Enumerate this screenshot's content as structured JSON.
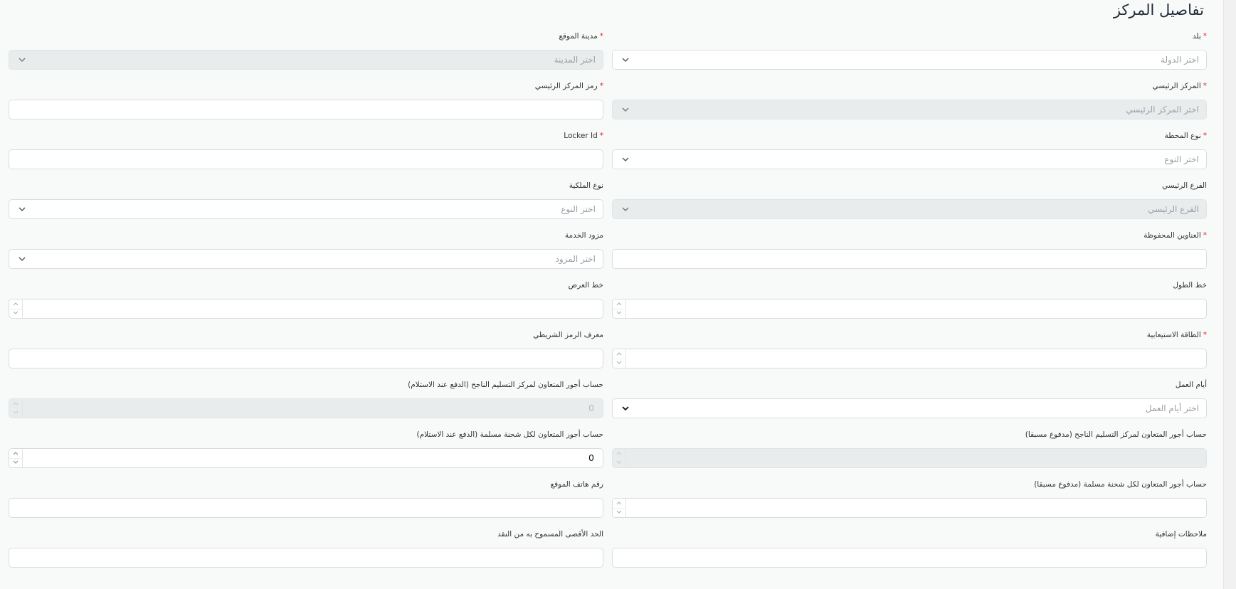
{
  "page_title": "تفاصيل المركز",
  "colors": {
    "required": "#e02424",
    "disabled_bg": "#e9ecec",
    "page_bg": "#f8f9f9"
  },
  "fields": {
    "country": {
      "label": "بلد",
      "required": true,
      "placeholder": "اختر الدولة",
      "type": "select",
      "icon": "chevron-down-icon"
    },
    "city": {
      "label": "مدينة الموقع",
      "required": true,
      "placeholder": "اختر المدينة",
      "type": "select",
      "disabled": true,
      "icon": "chevron-down-icon"
    },
    "main_center": {
      "label": "المركز الرئيسي",
      "required": true,
      "placeholder": "اختر المركز الرئيسي",
      "type": "select",
      "disabled": true,
      "icon": "chevron-down-icon"
    },
    "main_center_code": {
      "label": "رمز المركز الرئيسي",
      "required": true,
      "value": ""
    },
    "station_type": {
      "label": "نوع المحطة",
      "required": true,
      "placeholder": "اختر النوع",
      "type": "select",
      "icon": "chevron-down-icon"
    },
    "locker_id": {
      "label": "Locker Id",
      "required": true,
      "value": ""
    },
    "main_branch": {
      "label": "الفرع الرئيسي",
      "required": false,
      "placeholder": "الفرع الرئيسي",
      "type": "select",
      "disabled": true,
      "icon": "chevron-down-icon"
    },
    "ownership_type": {
      "label": "نوع الملكية",
      "required": false,
      "placeholder": "اختر النوع",
      "type": "select",
      "icon": "chevron-down-icon"
    },
    "saved_addresses": {
      "label": "العناوين المحفوظة",
      "required": true,
      "value": ""
    },
    "service_provider": {
      "label": "مزود الخدمة",
      "required": false,
      "placeholder": "اختر المزود",
      "type": "select",
      "icon": "chevron-down-icon"
    },
    "longitude": {
      "label": "خط الطول",
      "required": false,
      "value": "",
      "type": "number"
    },
    "latitude": {
      "label": "خط العرض",
      "required": false,
      "value": "",
      "type": "number"
    },
    "capacity": {
      "label": "الطاقة الاستيعابية",
      "required": true,
      "value": "",
      "type": "number"
    },
    "barcode_id": {
      "label": "معرف الرمز الشريطي",
      "required": false,
      "value": ""
    },
    "working_days": {
      "label": "أيام العمل",
      "required": false,
      "placeholder": "اختر أيام العمل",
      "type": "select",
      "icon": "chevron-down-icon"
    },
    "fee_cod_center": {
      "label": "حساب أجور المتعاون لمركز التسليم الناجح (الدفع عند الاستلام)",
      "required": false,
      "value": "0",
      "type": "number",
      "disabled": true
    },
    "fee_prepaid_center": {
      "label": "حساب أجور المتعاون لمركز التسليم الناجح (مدفوع مسبقا)",
      "required": false,
      "value": "",
      "type": "number",
      "disabled": true
    },
    "fee_cod_shipment": {
      "label": "حساب أجور المتعاون لكل شحنة مسلمة (الدفع عند الاستلام)",
      "required": false,
      "value": "0",
      "type": "number"
    },
    "fee_prepaid_shipment": {
      "label": "حساب أجور المتعاون لكل شحنة مسلمة (مدفوع مسبقا)",
      "required": false,
      "value": "",
      "type": "number"
    },
    "phone": {
      "label": "رقم هاتف الموقع",
      "required": false,
      "value": ""
    },
    "notes": {
      "label": "ملاحظات إضافية",
      "required": false,
      "value": ""
    },
    "max_cash": {
      "label": "الحد الأقصى المسموح به من النقد",
      "required": false,
      "value": ""
    }
  }
}
